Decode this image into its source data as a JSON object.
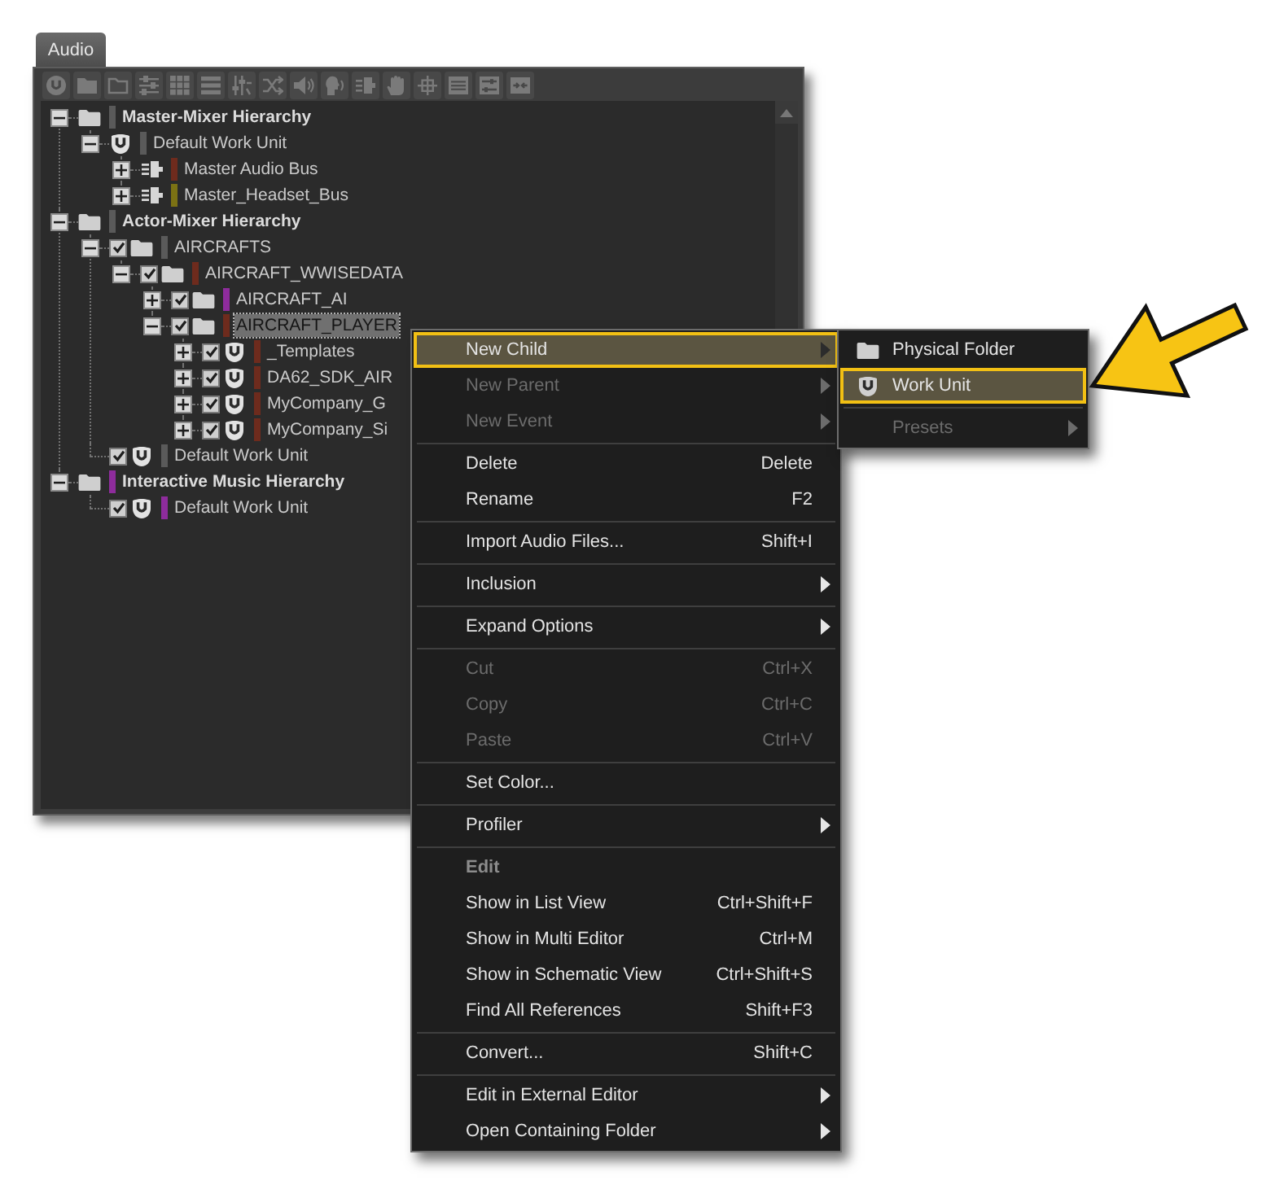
{
  "panel": {
    "tab": "Audio",
    "tree": [
      {
        "kind": "hierarchy",
        "label": "Master-Mixer Hierarchy",
        "color": "#5a5a5a",
        "expanded": true,
        "selected": false,
        "children": [
          {
            "kind": "work_unit",
            "label": "Default Work Unit",
            "color": "#5a5a5a",
            "expanded": true,
            "selected": false,
            "children": [
              {
                "kind": "bus",
                "label": "Master Audio Bus",
                "color": "#6e2b1d",
                "expanded": false,
                "selected": false
              },
              {
                "kind": "bus",
                "label": "Master_Headset_Bus",
                "color": "#7c7214",
                "expanded": false,
                "selected": false
              }
            ]
          }
        ]
      },
      {
        "kind": "hierarchy",
        "label": "Actor-Mixer Hierarchy",
        "color": "#5a5a5a",
        "expanded": true,
        "selected": false,
        "children": [
          {
            "kind": "folder",
            "label": "AIRCRAFTS",
            "color": "#5a5a5a",
            "checked": true,
            "expanded": true,
            "selected": false,
            "children": [
              {
                "kind": "folder",
                "label": "AIRCRAFT_WWISEDATA",
                "color": "#6e2b1d",
                "checked": true,
                "expanded": true,
                "selected": false,
                "children": [
                  {
                    "kind": "folder",
                    "label": "AIRCRAFT_AI",
                    "color": "#8e2c9c",
                    "checked": true,
                    "expanded": false,
                    "selected": false
                  },
                  {
                    "kind": "folder",
                    "label": "AIRCRAFT_PLAYER",
                    "color": "#6e2b1d",
                    "checked": true,
                    "expanded": true,
                    "selected": true,
                    "children": [
                      {
                        "kind": "work_unit",
                        "label": "_Templates",
                        "color": "#6e2b1d",
                        "checked": true,
                        "expanded": false,
                        "selected": false
                      },
                      {
                        "kind": "work_unit",
                        "label": "DA62_SDK_AIR",
                        "color": "#6e2b1d",
                        "checked": true,
                        "expanded": false,
                        "selected": false
                      },
                      {
                        "kind": "work_unit",
                        "label": "MyCompany_G",
                        "color": "#6e2b1d",
                        "checked": true,
                        "expanded": false,
                        "selected": false
                      },
                      {
                        "kind": "work_unit",
                        "label": "MyCompany_Si",
                        "color": "#6e2b1d",
                        "checked": true,
                        "expanded": false,
                        "selected": false
                      }
                    ]
                  }
                ]
              }
            ]
          },
          {
            "kind": "work_unit",
            "label": "Default Work Unit",
            "color": "#5a5a5a",
            "checked": true,
            "selected": false
          }
        ]
      },
      {
        "kind": "hierarchy",
        "label": "Interactive Music Hierarchy",
        "color": "#8e2c9c",
        "expanded": true,
        "selected": false,
        "children": [
          {
            "kind": "work_unit",
            "label": "Default Work Unit",
            "color": "#8e2c9c",
            "checked": true,
            "selected": false
          }
        ]
      }
    ]
  },
  "context_menu": {
    "items": [
      {
        "kind": "item",
        "label": "New Child",
        "has_submenu": true,
        "disabled": false,
        "selected": true
      },
      {
        "kind": "item",
        "label": "New Parent",
        "has_submenu": true,
        "disabled": true,
        "selected": false
      },
      {
        "kind": "item",
        "label": "New Event",
        "has_submenu": true,
        "disabled": true,
        "selected": false
      },
      {
        "kind": "separator"
      },
      {
        "kind": "item",
        "label": "Delete",
        "shortcut": "Delete",
        "has_submenu": false,
        "disabled": false,
        "selected": false
      },
      {
        "kind": "item",
        "label": "Rename",
        "shortcut": "F2",
        "has_submenu": false,
        "disabled": false,
        "selected": false
      },
      {
        "kind": "separator"
      },
      {
        "kind": "item",
        "label": "Import Audio Files...",
        "shortcut": "Shift+I",
        "has_submenu": false,
        "disabled": false,
        "selected": false
      },
      {
        "kind": "separator"
      },
      {
        "kind": "item",
        "label": "Inclusion",
        "has_submenu": true,
        "disabled": false,
        "selected": false
      },
      {
        "kind": "separator"
      },
      {
        "kind": "item",
        "label": "Expand Options",
        "has_submenu": true,
        "disabled": false,
        "selected": false
      },
      {
        "kind": "separator"
      },
      {
        "kind": "item",
        "label": "Cut",
        "shortcut": "Ctrl+X",
        "has_submenu": false,
        "disabled": true,
        "selected": false
      },
      {
        "kind": "item",
        "label": "Copy",
        "shortcut": "Ctrl+C",
        "has_submenu": false,
        "disabled": true,
        "selected": false
      },
      {
        "kind": "item",
        "label": "Paste",
        "shortcut": "Ctrl+V",
        "has_submenu": false,
        "disabled": true,
        "selected": false
      },
      {
        "kind": "separator"
      },
      {
        "kind": "item",
        "label": "Set Color...",
        "has_submenu": false,
        "disabled": false,
        "selected": false
      },
      {
        "kind": "separator"
      },
      {
        "kind": "item",
        "label": "Profiler",
        "has_submenu": true,
        "disabled": false,
        "selected": false
      },
      {
        "kind": "separator"
      },
      {
        "kind": "header",
        "label": "Edit"
      },
      {
        "kind": "item",
        "label": "Show in List View",
        "shortcut": "Ctrl+Shift+F",
        "has_submenu": false,
        "disabled": false,
        "selected": false
      },
      {
        "kind": "item",
        "label": "Show in Multi Editor",
        "shortcut": "Ctrl+M",
        "has_submenu": false,
        "disabled": false,
        "selected": false
      },
      {
        "kind": "item",
        "label": "Show in Schematic View",
        "shortcut": "Ctrl+Shift+S",
        "has_submenu": false,
        "disabled": false,
        "selected": false
      },
      {
        "kind": "item",
        "label": "Find All References",
        "shortcut": "Shift+F3",
        "has_submenu": false,
        "disabled": false,
        "selected": false
      },
      {
        "kind": "separator"
      },
      {
        "kind": "item",
        "label": "Convert...",
        "shortcut": "Shift+C",
        "has_submenu": false,
        "disabled": false,
        "selected": false
      },
      {
        "kind": "separator"
      },
      {
        "kind": "item",
        "label": "Edit in External Editor",
        "has_submenu": true,
        "disabled": false,
        "selected": false
      },
      {
        "kind": "item",
        "label": "Open Containing Folder",
        "has_submenu": true,
        "disabled": false,
        "selected": false
      }
    ]
  },
  "submenu": {
    "items": [
      {
        "kind": "folder",
        "label": "Physical Folder",
        "has_submenu": false,
        "disabled": false,
        "selected": false
      },
      {
        "kind": "work_unit",
        "label": "Work Unit",
        "has_submenu": false,
        "disabled": false,
        "selected": true
      },
      {
        "kind": "separator"
      },
      {
        "kind": "item",
        "label": "Presets",
        "has_submenu": true,
        "disabled": true,
        "selected": false
      }
    ]
  }
}
